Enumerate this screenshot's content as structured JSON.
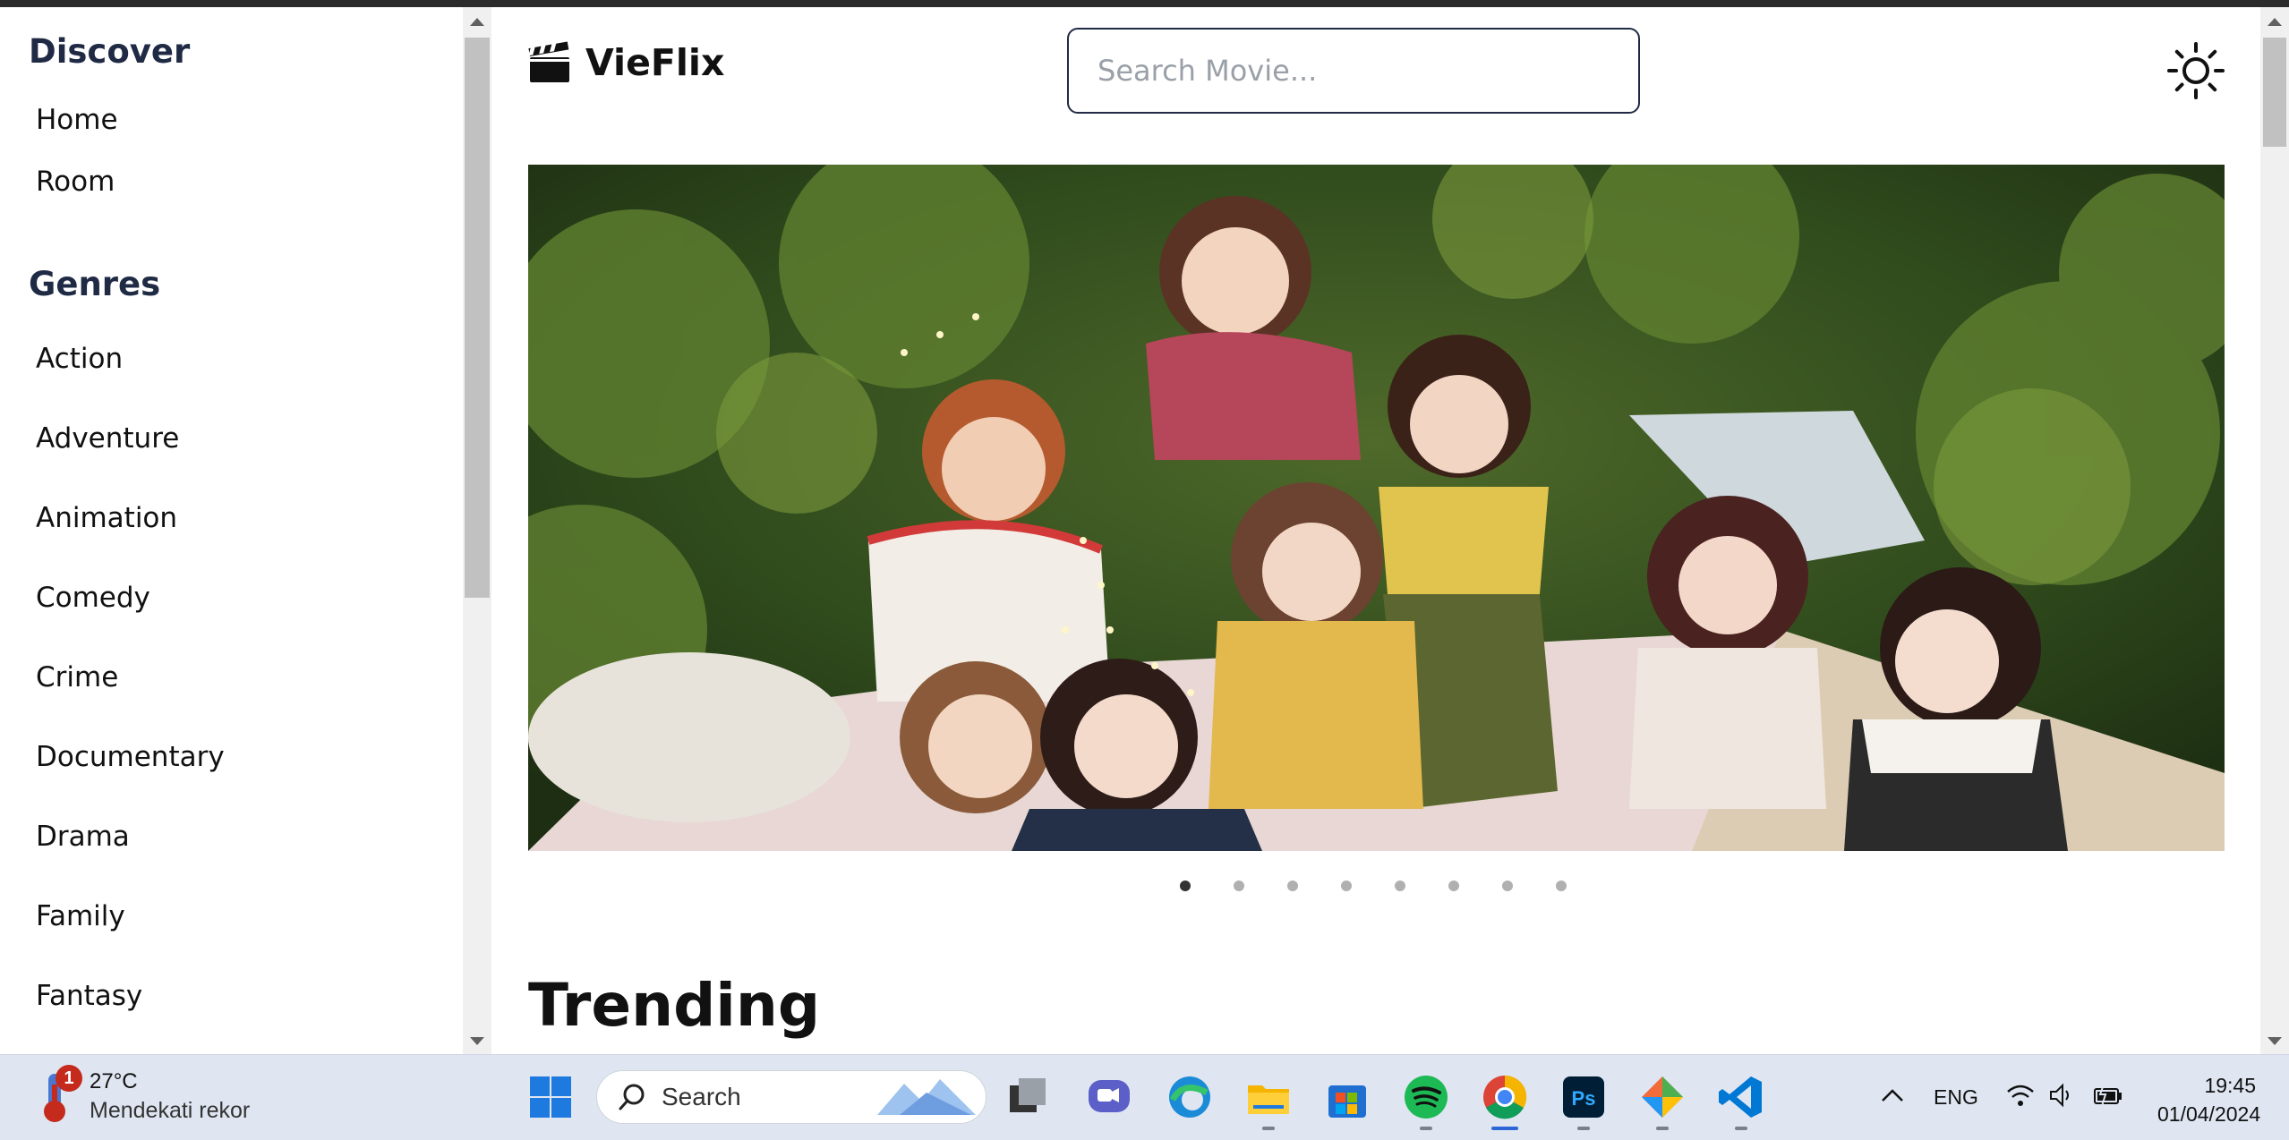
{
  "sidebar": {
    "discover_title": "Discover",
    "discover_items": [
      "Home",
      "Room"
    ],
    "genres_title": "Genres",
    "genres": [
      "Action",
      "Adventure",
      "Animation",
      "Comedy",
      "Crime",
      "Documentary",
      "Drama",
      "Family",
      "Fantasy"
    ]
  },
  "header": {
    "logo_text": "VieFlix",
    "search_placeholder": "Search Movie...",
    "theme_icon": "sun-icon"
  },
  "carousel": {
    "slide_count": 8,
    "active_index": 0,
    "image": "group-photo"
  },
  "main": {
    "section_title": "Trending"
  },
  "taskbar": {
    "weather_temp": "27°C",
    "weather_desc": "Mendekati rekor",
    "weather_badge": "1",
    "search_label": "Search",
    "apps": [
      "start-icon",
      "task-view-icon",
      "chat-icon",
      "edge-icon",
      "file-explorer-icon",
      "store-icon",
      "spotify-icon",
      "chrome-icon",
      "photoshop-icon",
      "app-icon",
      "vscode-icon"
    ],
    "language": "ENG",
    "time": "19:45",
    "date": "01/04/2024"
  }
}
